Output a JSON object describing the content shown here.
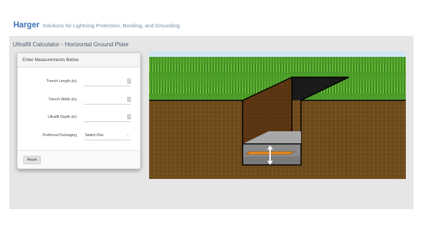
{
  "header": {
    "brand": "Harger",
    "tagline": "Solutions for Lightning Protection, Bonding, and Grounding"
  },
  "page": {
    "title": "Ultrafill Calculator - Horizontal Ground Plate"
  },
  "panel": {
    "heading": "Enter Measurements Below",
    "fields": [
      {
        "label": "Trench Length (in)",
        "value": ""
      },
      {
        "label": "Trench Width (in)",
        "value": ""
      },
      {
        "label": "Ultrafill Depth (in)",
        "value": ""
      }
    ],
    "packaging": {
      "label": "Preferred Packaging",
      "selected": "Select One"
    },
    "reset_label": "Reset"
  },
  "icons": {
    "spinner": "number-spinner-icon",
    "caret": "chevron-down-icon",
    "depth_arrow": "double-arrow-vertical-icon"
  },
  "colors": {
    "brand": "#3b6fb6",
    "tagline": "#7b8fa8",
    "sky": "#cfe4f4",
    "grass": "#4a9a28",
    "soil": "#6e4b1c",
    "trench_wall": "#5a3512",
    "ultrafill": "#8a8a8a",
    "ground_plate": "#e8891e"
  }
}
